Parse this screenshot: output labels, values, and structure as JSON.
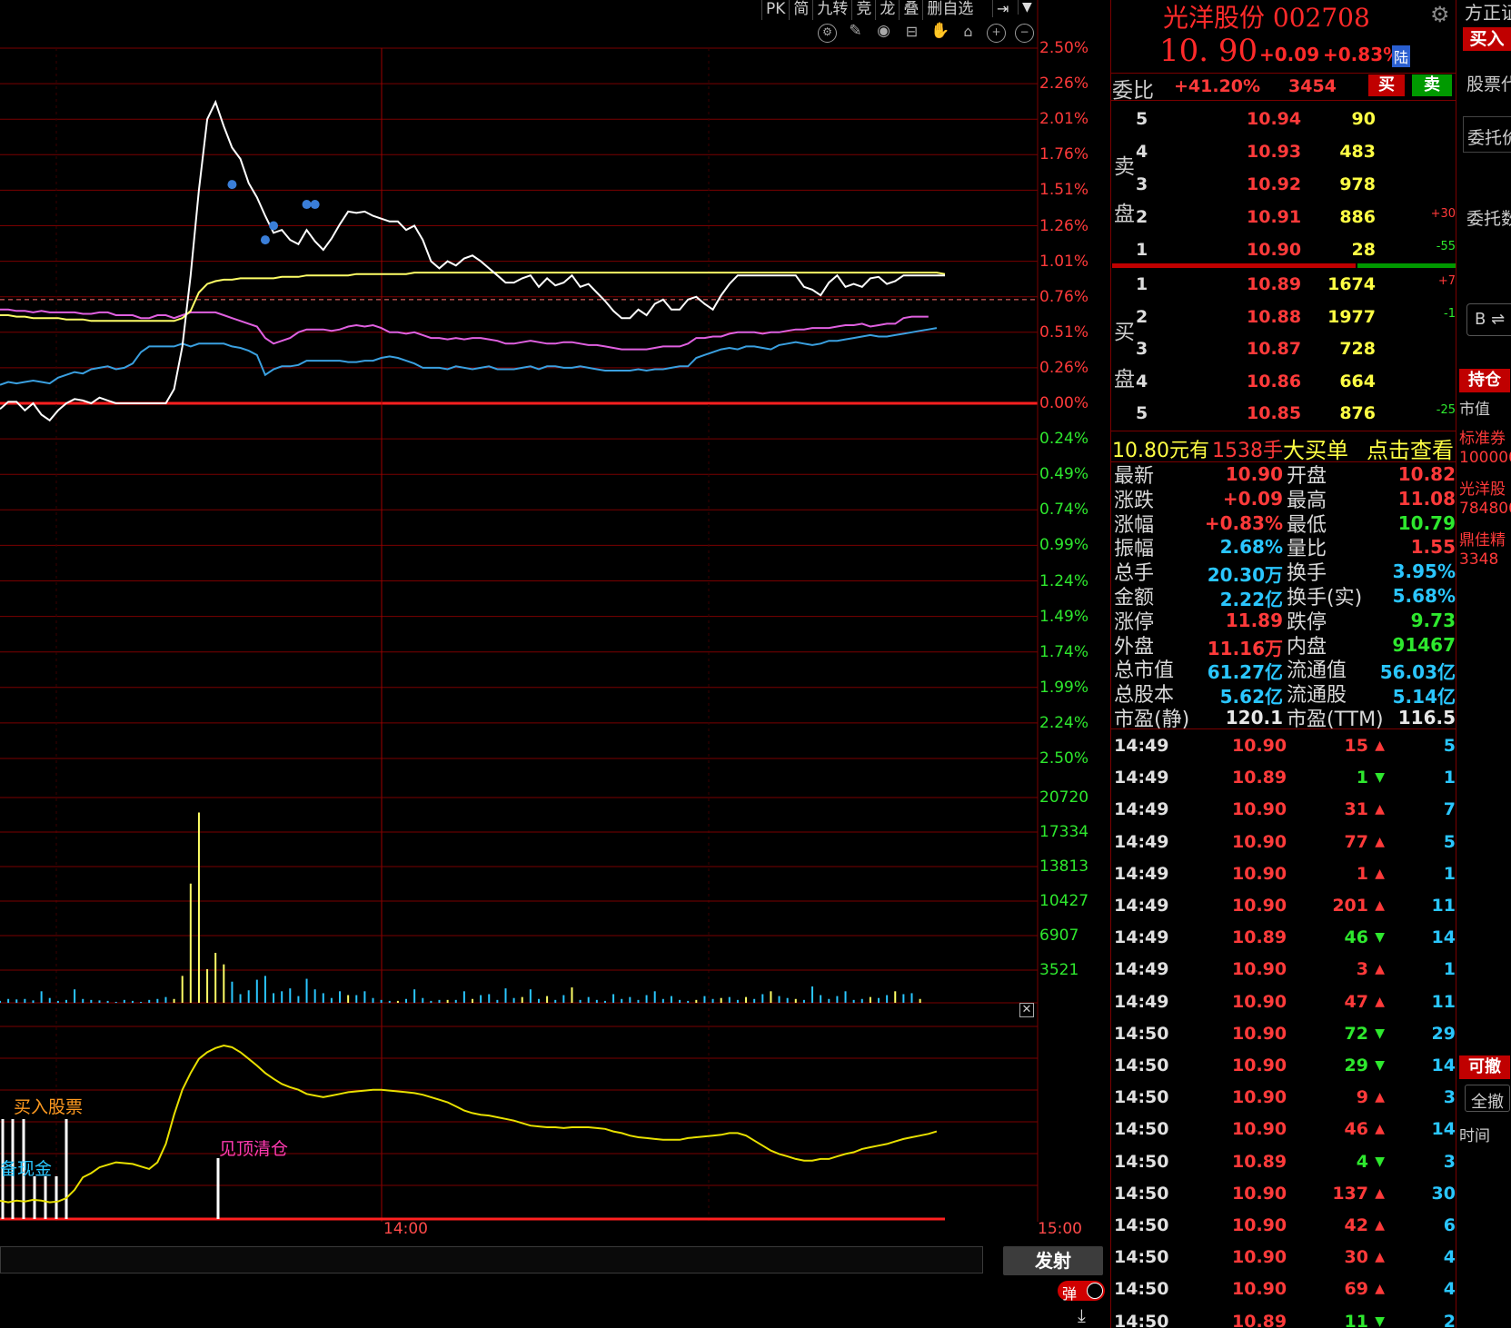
{
  "toolbar": {
    "buttons": [
      "PK",
      "简",
      "九转",
      "竞",
      "龙",
      "叠",
      "删自选"
    ]
  },
  "chart": {
    "y_pct_labels_up": [
      "2.50%",
      "2.26%",
      "2.01%",
      "1.76%",
      "1.51%",
      "1.26%",
      "1.01%",
      "0.76%",
      "0.51%",
      "0.26%",
      "0.00%"
    ],
    "y_pct_labels_down": [
      "0.24%",
      "0.49%",
      "0.74%",
      "0.99%",
      "1.24%",
      "1.49%",
      "1.74%",
      "1.99%",
      "2.24%",
      "2.50%"
    ],
    "volume_labels": [
      "20720",
      "17334",
      "13813",
      "10427",
      "6907",
      "3521"
    ],
    "x_mid_label": "14:00",
    "x_end_label": "15:00",
    "signal_buy": "买入股票",
    "signal_cash": "备现金",
    "signal_sell": "见顶清仓",
    "colors": {
      "price_line": "#ffffff",
      "avg_line": "#ffff66",
      "pink_line": "#e060e0",
      "blue_line": "#3aa0e0",
      "grid": "#7a0000",
      "up": "#ff3a3a",
      "down": "#2ee82e",
      "ref": "#ff7070"
    }
  },
  "bottom": {
    "fire_button": "发射",
    "toggle_label": "弹"
  },
  "stock": {
    "name_code": "光洋股份 002708",
    "price": "10. 90",
    "change": "+0.09",
    "change_pct": "+0.83%",
    "market_badge": "陆",
    "weibi_label": "委比",
    "weibi_pct": "+41.20%",
    "weibi_diff": "3454",
    "buy_btn": "买",
    "sell_btn": "卖",
    "sell_label": "卖盘",
    "buy_label": "买盘"
  },
  "asks": [
    {
      "level": "5",
      "price": "10.94",
      "vol": "90",
      "chg": ""
    },
    {
      "level": "4",
      "price": "10.93",
      "vol": "483",
      "chg": ""
    },
    {
      "level": "3",
      "price": "10.92",
      "vol": "978",
      "chg": ""
    },
    {
      "level": "2",
      "price": "10.91",
      "vol": "886",
      "chg": "+30"
    },
    {
      "level": "1",
      "price": "10.90",
      "vol": "28",
      "chg": "-55"
    }
  ],
  "bids": [
    {
      "level": "1",
      "price": "10.89",
      "vol": "1674",
      "chg": "+7"
    },
    {
      "level": "2",
      "price": "10.88",
      "vol": "1977",
      "chg": "-1"
    },
    {
      "level": "3",
      "price": "10.87",
      "vol": "728",
      "chg": ""
    },
    {
      "level": "4",
      "price": "10.86",
      "vol": "664",
      "chg": ""
    },
    {
      "level": "5",
      "price": "10.85",
      "vol": "876",
      "chg": "-25"
    }
  ],
  "big_order": {
    "price": "10.80元有",
    "qty": "1538手",
    "label": "大买单",
    "link": "点击查看"
  },
  "stats": [
    {
      "l1": "最新",
      "v1": "10.90",
      "c1": "r",
      "l2": "开盘",
      "v2": "10.82",
      "c2": "r"
    },
    {
      "l1": "涨跌",
      "v1": "+0.09",
      "c1": "r",
      "l2": "最高",
      "v2": "11.08",
      "c2": "r"
    },
    {
      "l1": "涨幅",
      "v1": "+0.83%",
      "c1": "r",
      "l2": "最低",
      "v2": "10.79",
      "c2": "g"
    },
    {
      "l1": "振幅",
      "v1": "2.68%",
      "c1": "c",
      "l2": "量比",
      "v2": "1.55",
      "c2": "r"
    },
    {
      "l1": "总手",
      "v1": "20.30万",
      "c1": "c",
      "l2": "换手",
      "v2": "3.95%",
      "c2": "c"
    },
    {
      "l1": "金额",
      "v1": "2.22亿",
      "c1": "c",
      "l2": "换手(实)",
      "v2": "5.68%",
      "c2": "c"
    },
    {
      "l1": "涨停",
      "v1": "11.89",
      "c1": "r",
      "l2": "跌停",
      "v2": "9.73",
      "c2": "g"
    },
    {
      "l1": "外盘",
      "v1": "11.16万",
      "c1": "r",
      "l2": "内盘",
      "v2": "91467",
      "c2": "g"
    },
    {
      "l1": "总市值",
      "v1": "61.27亿",
      "c1": "c",
      "l2": "流通值",
      "v2": "56.03亿",
      "c2": "c"
    },
    {
      "l1": "总股本",
      "v1": "5.62亿",
      "c1": "c",
      "l2": "流通股",
      "v2": "5.14亿",
      "c2": "c"
    },
    {
      "l1": "市盈(静)",
      "v1": "120.1",
      "c1": "w",
      "l2": "市盈(TTM)",
      "v2": "116.5",
      "c2": "w"
    }
  ],
  "ticks": [
    {
      "t": "14:49",
      "p": "10.90",
      "pc": "r",
      "v": "15",
      "dir": "up",
      "n": "5"
    },
    {
      "t": "14:49",
      "p": "10.89",
      "pc": "r",
      "v": "1",
      "dir": "down",
      "n": "1"
    },
    {
      "t": "14:49",
      "p": "10.90",
      "pc": "r",
      "v": "31",
      "dir": "up",
      "n": "7"
    },
    {
      "t": "14:49",
      "p": "10.90",
      "pc": "r",
      "v": "77",
      "dir": "up",
      "n": "5"
    },
    {
      "t": "14:49",
      "p": "10.90",
      "pc": "r",
      "v": "1",
      "dir": "up",
      "n": "1"
    },
    {
      "t": "14:49",
      "p": "10.90",
      "pc": "r",
      "v": "201",
      "dir": "up",
      "n": "11"
    },
    {
      "t": "14:49",
      "p": "10.89",
      "pc": "r",
      "v": "46",
      "dir": "down",
      "n": "14"
    },
    {
      "t": "14:49",
      "p": "10.90",
      "pc": "r",
      "v": "3",
      "dir": "up",
      "n": "1"
    },
    {
      "t": "14:49",
      "p": "10.90",
      "pc": "r",
      "v": "47",
      "dir": "up",
      "n": "11"
    },
    {
      "t": "14:50",
      "p": "10.90",
      "pc": "r",
      "v": "72",
      "dir": "down",
      "n": "29"
    },
    {
      "t": "14:50",
      "p": "10.90",
      "pc": "r",
      "v": "29",
      "dir": "down",
      "n": "14"
    },
    {
      "t": "14:50",
      "p": "10.90",
      "pc": "r",
      "v": "9",
      "dir": "up",
      "n": "3"
    },
    {
      "t": "14:50",
      "p": "10.90",
      "pc": "r",
      "v": "46",
      "dir": "up",
      "n": "14"
    },
    {
      "t": "14:50",
      "p": "10.89",
      "pc": "r",
      "v": "4",
      "dir": "down",
      "n": "3"
    },
    {
      "t": "14:50",
      "p": "10.90",
      "pc": "r",
      "v": "137",
      "dir": "up",
      "n": "30"
    },
    {
      "t": "14:50",
      "p": "10.90",
      "pc": "r",
      "v": "42",
      "dir": "up",
      "n": "6"
    },
    {
      "t": "14:50",
      "p": "10.90",
      "pc": "r",
      "v": "30",
      "dir": "up",
      "n": "4"
    },
    {
      "t": "14:50",
      "p": "10.90",
      "pc": "r",
      "v": "69",
      "dir": "up",
      "n": "4"
    },
    {
      "t": "14:50",
      "p": "10.89",
      "pc": "r",
      "v": "11",
      "dir": "down",
      "n": "2"
    }
  ],
  "side": {
    "broker": "方正证",
    "buy_tab": "买入",
    "stock_code_label": "股票代",
    "order_price": "委托价",
    "order_qty": "委托数",
    "b_switch": "B ⇌",
    "holdings_tab": "持仓",
    "market_value": "市值",
    "std_bond": "标准券",
    "val1": "100000",
    "stock_name": "光洋股",
    "val2": "784800",
    "jiajia": "鼎佳精",
    "val3": "3348",
    "cancelable_tab": "可撤",
    "cancel_all": "全撤",
    "time_label": "时间"
  },
  "chart_data": {
    "type": "line",
    "x_label_mid": "14:00",
    "x_label_end": "15:00",
    "price_pct": [
      -0.04,
      0.01,
      0.01,
      -0.05,
      0.0,
      -0.08,
      -0.12,
      -0.05,
      0.0,
      0.03,
      0.02,
      0.0,
      0.04,
      0.02,
      0.0,
      0.0,
      0.0,
      0.0,
      0.0,
      0.0,
      0.0,
      0.1,
      0.4,
      0.9,
      1.5,
      2.0,
      2.12,
      1.95,
      1.8,
      1.72,
      1.55,
      1.45,
      1.32,
      1.2,
      1.22,
      1.15,
      1.12,
      1.22,
      1.14,
      1.08,
      1.16,
      1.26,
      1.35,
      1.34,
      1.35,
      1.32,
      1.3,
      1.28,
      1.28,
      1.22,
      1.25,
      1.15,
      1.0,
      0.95,
      1.0,
      0.97,
      1.02,
      1.04,
      1.0,
      0.95,
      0.9,
      0.85,
      0.85,
      0.88,
      0.9,
      0.82,
      0.88,
      0.83,
      0.85,
      0.9,
      0.82,
      0.84,
      0.78,
      0.72,
      0.65,
      0.6,
      0.6,
      0.66,
      0.62,
      0.7,
      0.73,
      0.66,
      0.66,
      0.73,
      0.75,
      0.7,
      0.66,
      0.76,
      0.84,
      0.9,
      0.9,
      0.9,
      0.9,
      0.9,
      0.9,
      0.9,
      0.9,
      0.82,
      0.8,
      0.76,
      0.85,
      0.9,
      0.82,
      0.84,
      0.82,
      0.88,
      0.89,
      0.84,
      0.86,
      0.9,
      0.9,
      0.9,
      0.9,
      0.9,
      0.9
    ],
    "avg_pct": [
      0.62,
      0.62,
      0.61,
      0.61,
      0.6,
      0.6,
      0.6,
      0.6,
      0.59,
      0.59,
      0.59,
      0.58,
      0.58,
      0.58,
      0.58,
      0.58,
      0.58,
      0.58,
      0.58,
      0.58,
      0.58,
      0.58,
      0.6,
      0.65,
      0.78,
      0.84,
      0.86,
      0.87,
      0.87,
      0.88,
      0.88,
      0.88,
      0.88,
      0.88,
      0.89,
      0.89,
      0.89,
      0.9,
      0.9,
      0.9,
      0.9,
      0.9,
      0.9,
      0.91,
      0.91,
      0.91,
      0.91,
      0.91,
      0.91,
      0.91,
      0.92,
      0.92,
      0.92,
      0.92,
      0.92,
      0.92,
      0.92,
      0.92,
      0.92,
      0.92,
      0.92,
      0.92,
      0.92,
      0.92,
      0.92,
      0.92,
      0.92,
      0.92,
      0.92,
      0.92,
      0.92,
      0.92,
      0.92,
      0.92,
      0.92,
      0.92,
      0.92,
      0.92,
      0.92,
      0.92,
      0.92,
      0.92,
      0.92,
      0.92,
      0.92,
      0.92,
      0.92,
      0.92,
      0.92,
      0.92,
      0.92,
      0.92,
      0.92,
      0.92,
      0.92,
      0.92,
      0.92,
      0.92,
      0.92,
      0.92,
      0.92,
      0.92,
      0.92,
      0.92,
      0.92,
      0.92,
      0.92,
      0.92,
      0.92,
      0.92,
      0.92,
      0.92,
      0.92,
      0.92,
      0.91
    ],
    "pink_pct": [
      0.66,
      0.66,
      0.65,
      0.65,
      0.64,
      0.65,
      0.64,
      0.64,
      0.64,
      0.64,
      0.63,
      0.63,
      0.64,
      0.64,
      0.62,
      0.62,
      0.62,
      0.6,
      0.6,
      0.62,
      0.62,
      0.6,
      0.62,
      0.64,
      0.64,
      0.64,
      0.64,
      0.62,
      0.6,
      0.58,
      0.56,
      0.54,
      0.46,
      0.42,
      0.44,
      0.46,
      0.5,
      0.52,
      0.52,
      0.52,
      0.51,
      0.52,
      0.54,
      0.55,
      0.54,
      0.55,
      0.53,
      0.5,
      0.5,
      0.49,
      0.5,
      0.48,
      0.46,
      0.46,
      0.45,
      0.46,
      0.45,
      0.46,
      0.46,
      0.45,
      0.44,
      0.42,
      0.42,
      0.43,
      0.44,
      0.43,
      0.42,
      0.42,
      0.43,
      0.43,
      0.42,
      0.41,
      0.41,
      0.4,
      0.39,
      0.38,
      0.38,
      0.38,
      0.38,
      0.39,
      0.4,
      0.4,
      0.4,
      0.42,
      0.46,
      0.46,
      0.47,
      0.47,
      0.49,
      0.5,
      0.5,
      0.5,
      0.49,
      0.5,
      0.5,
      0.51,
      0.52,
      0.52,
      0.53,
      0.53,
      0.53,
      0.54,
      0.55,
      0.55,
      0.56,
      0.54,
      0.55,
      0.56,
      0.56,
      0.6,
      0.61,
      0.61,
      0.61
    ],
    "blue_pct": [
      0.13,
      0.15,
      0.14,
      0.15,
      0.16,
      0.15,
      0.14,
      0.18,
      0.2,
      0.22,
      0.21,
      0.24,
      0.25,
      0.26,
      0.24,
      0.25,
      0.28,
      0.36,
      0.4,
      0.4,
      0.4,
      0.4,
      0.42,
      0.4,
      0.42,
      0.42,
      0.42,
      0.42,
      0.4,
      0.39,
      0.37,
      0.34,
      0.2,
      0.24,
      0.26,
      0.26,
      0.27,
      0.3,
      0.3,
      0.3,
      0.3,
      0.3,
      0.29,
      0.29,
      0.3,
      0.3,
      0.32,
      0.33,
      0.32,
      0.3,
      0.28,
      0.25,
      0.25,
      0.25,
      0.24,
      0.26,
      0.25,
      0.24,
      0.25,
      0.26,
      0.24,
      0.24,
      0.24,
      0.25,
      0.26,
      0.24,
      0.26,
      0.26,
      0.25,
      0.25,
      0.26,
      0.25,
      0.24,
      0.23,
      0.23,
      0.23,
      0.23,
      0.24,
      0.23,
      0.24,
      0.24,
      0.25,
      0.26,
      0.26,
      0.32,
      0.34,
      0.36,
      0.38,
      0.39,
      0.38,
      0.4,
      0.4,
      0.39,
      0.38,
      0.41,
      0.42,
      0.43,
      0.42,
      0.41,
      0.42,
      0.44,
      0.44,
      0.45,
      0.46,
      0.47,
      0.48,
      0.47,
      0.47,
      0.48,
      0.49,
      0.5,
      0.51,
      0.52,
      0.53
    ],
    "dots": [
      {
        "i": 28,
        "pct": 1.54
      },
      {
        "i": 32,
        "pct": 1.15
      },
      {
        "i": 33,
        "pct": 1.25
      },
      {
        "i": 37,
        "pct": 1.4
      },
      {
        "i": 38,
        "pct": 1.4
      }
    ],
    "volume": [
      200,
      400,
      350,
      400,
      250,
      1200,
      500,
      200,
      300,
      1400,
      400,
      300,
      250,
      200,
      100,
      300,
      200,
      100,
      300,
      400,
      600,
      400,
      2800,
      12400,
      19800,
      3500,
      5200,
      4000,
      2200,
      900,
      1300,
      2400,
      2800,
      1000,
      1200,
      1500,
      700,
      2500,
      1400,
      1000,
      500,
      1200,
      800,
      800,
      1200,
      500,
      300,
      200,
      200,
      400,
      1400,
      500,
      200,
      300,
      300,
      300,
      1200,
      400,
      800,
      900,
      300,
      1500,
      500,
      600,
      1400,
      400,
      700,
      300,
      800,
      1600,
      300,
      600,
      300,
      200,
      900,
      400,
      600,
      300,
      800,
      1200,
      400,
      700,
      300,
      200,
      300,
      700,
      400,
      500,
      600,
      300,
      600,
      400,
      900,
      1200,
      700,
      500,
      400,
      300,
      1700,
      800,
      400,
      700,
      1200,
      300,
      400,
      600,
      500,
      800,
      1200,
      900,
      1000,
      400
    ],
    "volume_colors": "mixed",
    "indicator": [
      0.22,
      0.2,
      0.22,
      0.21,
      0.23,
      0.22,
      0.2,
      0.21,
      0.25,
      0.35,
      0.5,
      0.55,
      0.62,
      0.65,
      0.68,
      0.67,
      0.66,
      0.63,
      0.6,
      0.68,
      0.9,
      1.25,
      1.55,
      1.75,
      1.92,
      2.0,
      2.05,
      2.08,
      2.06,
      2.0,
      1.92,
      1.84,
      1.75,
      1.68,
      1.62,
      1.58,
      1.55,
      1.5,
      1.48,
      1.46,
      1.48,
      1.5,
      1.52,
      1.53,
      1.54,
      1.55,
      1.55,
      1.54,
      1.53,
      1.52,
      1.51,
      1.49,
      1.46,
      1.43,
      1.4,
      1.35,
      1.3,
      1.27,
      1.25,
      1.24,
      1.22,
      1.2,
      1.18,
      1.15,
      1.12,
      1.11,
      1.1,
      1.1,
      1.09,
      1.1,
      1.1,
      1.1,
      1.09,
      1.08,
      1.05,
      1.03,
      1.0,
      0.98,
      0.97,
      0.96,
      0.95,
      0.95,
      0.95,
      0.97,
      0.98,
      0.99,
      1.0,
      1.01,
      1.03,
      1.03,
      1.0,
      0.94,
      0.88,
      0.82,
      0.78,
      0.75,
      0.72,
      0.7,
      0.7,
      0.72,
      0.72,
      0.75,
      0.78,
      0.8,
      0.84,
      0.86,
      0.88,
      0.9,
      0.93,
      0.96,
      0.98,
      1.0,
      1.02,
      1.05
    ],
    "ymin_pct": -2.5,
    "ymax_pct": 2.5
  }
}
